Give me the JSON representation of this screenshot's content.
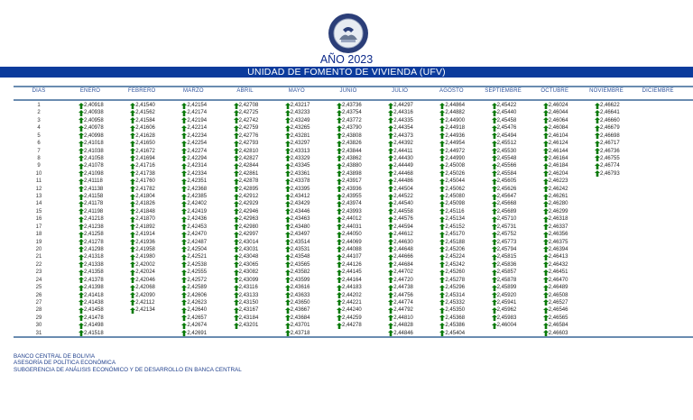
{
  "header": {
    "year_title": "AÑO 2023",
    "band_title": "UNIDAD DE FOMENTO DE VIVIENDA (UFV)",
    "seal_text": "BANCO CENTRAL DE BOLIVIA"
  },
  "table": {
    "day_header": "DIAS",
    "months": [
      "ENERO",
      "FEBRERO",
      "MARZO",
      "ABRIL",
      "MAYO",
      "JUNIO",
      "JULIO",
      "AGOSTO",
      "SEPTIEMBRE",
      "OCTUBRE",
      "NOVIEMBRE",
      "DICIEMBRE"
    ],
    "days": [
      "1",
      "2",
      "3",
      "4",
      "5",
      "6",
      "7",
      "8",
      "9",
      "10",
      "11",
      "12",
      "13",
      "14",
      "15",
      "16",
      "17",
      "18",
      "19",
      "20",
      "21",
      "22",
      "23",
      "24",
      "25",
      "26",
      "27",
      "28",
      "29",
      "30",
      "31"
    ],
    "trend_icon": "green-up-arrow-icon",
    "trend_color": "#0a7a0a",
    "values": [
      [
        "2,40918",
        "2,40938",
        "2,40958",
        "2,40978",
        "2,40998",
        "2,41018",
        "2,41038",
        "2,41058",
        "2,41078",
        "2,41098",
        "2,41118",
        "2,41138",
        "2,41158",
        "2,41178",
        "2,41198",
        "2,41218",
        "2,41238",
        "2,41258",
        "2,41278",
        "2,41298",
        "2,41318",
        "2,41338",
        "2,41358",
        "2,41378",
        "2,41398",
        "2,41418",
        "2,41438",
        "2,41458",
        "2,41478",
        "2,41498",
        "2,41518"
      ],
      [
        "2,41540",
        "2,41562",
        "2,41584",
        "2,41606",
        "2,41628",
        "2,41650",
        "2,41672",
        "2,41694",
        "2,41716",
        "2,41738",
        "2,41760",
        "2,41782",
        "2,41804",
        "2,41826",
        "2,41848",
        "2,41870",
        "2,41892",
        "2,41914",
        "2,41936",
        "2,41958",
        "2,41980",
        "2,42002",
        "2,42024",
        "2,42046",
        "2,42068",
        "2,42090",
        "2,42112",
        "2,42134"
      ],
      [
        "2,42154",
        "2,42174",
        "2,42194",
        "2,42214",
        "2,42234",
        "2,42254",
        "2,42274",
        "2,42294",
        "2,42314",
        "2,42334",
        "2,42351",
        "2,42368",
        "2,42385",
        "2,42402",
        "2,42419",
        "2,42436",
        "2,42453",
        "2,42470",
        "2,42487",
        "2,42504",
        "2,42521",
        "2,42538",
        "2,42555",
        "2,42572",
        "2,42589",
        "2,42606",
        "2,42623",
        "2,42640",
        "2,42657",
        "2,42674",
        "2,42691"
      ],
      [
        "2,42708",
        "2,42725",
        "2,42742",
        "2,42759",
        "2,42776",
        "2,42793",
        "2,42810",
        "2,42827",
        "2,42844",
        "2,42861",
        "2,42878",
        "2,42895",
        "2,42912",
        "2,42929",
        "2,42946",
        "2,42963",
        "2,42980",
        "2,42997",
        "2,43014",
        "2,43031",
        "2,43048",
        "2,43065",
        "2,43082",
        "2,43099",
        "2,43116",
        "2,43133",
        "2,43150",
        "2,43167",
        "2,43184",
        "2,43201"
      ],
      [
        "2,43217",
        "2,43233",
        "2,43249",
        "2,43265",
        "2,43281",
        "2,43297",
        "2,43313",
        "2,43329",
        "2,43345",
        "2,43361",
        "2,43378",
        "2,43395",
        "2,43412",
        "2,43429",
        "2,43446",
        "2,43463",
        "2,43480",
        "2,43497",
        "2,43514",
        "2,43531",
        "2,43548",
        "2,43565",
        "2,43582",
        "2,43599",
        "2,43616",
        "2,43633",
        "2,43650",
        "2,43667",
        "2,43684",
        "2,43701",
        "2,43718"
      ],
      [
        "2,43736",
        "2,43754",
        "2,43772",
        "2,43790",
        "2,43808",
        "2,43826",
        "2,43844",
        "2,43862",
        "2,43880",
        "2,43898",
        "2,43917",
        "2,43936",
        "2,43955",
        "2,43974",
        "2,43993",
        "2,44012",
        "2,44031",
        "2,44050",
        "2,44069",
        "2,44088",
        "2,44107",
        "2,44126",
        "2,44145",
        "2,44164",
        "2,44183",
        "2,44202",
        "2,44221",
        "2,44240",
        "2,44259",
        "2,44278"
      ],
      [
        "2,44297",
        "2,44316",
        "2,44335",
        "2,44354",
        "2,44373",
        "2,44392",
        "2,44411",
        "2,44430",
        "2,44449",
        "2,44468",
        "2,44486",
        "2,44504",
        "2,44522",
        "2,44540",
        "2,44558",
        "2,44576",
        "2,44594",
        "2,44612",
        "2,44630",
        "2,44648",
        "2,44666",
        "2,44684",
        "2,44702",
        "2,44720",
        "2,44738",
        "2,44756",
        "2,44774",
        "2,44792",
        "2,44810",
        "2,44828",
        "2,44846"
      ],
      [
        "2,44864",
        "2,44882",
        "2,44900",
        "2,44918",
        "2,44936",
        "2,44954",
        "2,44972",
        "2,44990",
        "2,45008",
        "2,45026",
        "2,45044",
        "2,45062",
        "2,45080",
        "2,45098",
        "2,45116",
        "2,45134",
        "2,45152",
        "2,45170",
        "2,45188",
        "2,45206",
        "2,45224",
        "2,45242",
        "2,45260",
        "2,45278",
        "2,45296",
        "2,45314",
        "2,45332",
        "2,45350",
        "2,45368",
        "2,45386",
        "2,45404"
      ],
      [
        "2,45422",
        "2,45440",
        "2,45458",
        "2,45476",
        "2,45494",
        "2,45512",
        "2,45530",
        "2,45548",
        "2,45566",
        "2,45584",
        "2,45605",
        "2,45626",
        "2,45647",
        "2,45668",
        "2,45689",
        "2,45710",
        "2,45731",
        "2,45752",
        "2,45773",
        "2,45794",
        "2,45815",
        "2,45836",
        "2,45857",
        "2,45878",
        "2,45899",
        "2,45920",
        "2,45941",
        "2,45962",
        "2,45983",
        "2,46004"
      ],
      [
        "2,46024",
        "2,46044",
        "2,46064",
        "2,46084",
        "2,46104",
        "2,46124",
        "2,46144",
        "2,46164",
        "2,46184",
        "2,46204",
        "2,46223",
        "2,46242",
        "2,46261",
        "2,46280",
        "2,46299",
        "2,46318",
        "2,46337",
        "2,46356",
        "2,46375",
        "2,46394",
        "2,46413",
        "2,46432",
        "2,46451",
        "2,46470",
        "2,46489",
        "2,46508",
        "2,46527",
        "2,46546",
        "2,46565",
        "2,46584",
        "2,46603"
      ],
      [
        "2,46622",
        "2,46641",
        "2,46660",
        "2,46679",
        "2,46698",
        "2,46717",
        "2,46736",
        "2,46755",
        "2,46774",
        "2,46793"
      ],
      []
    ]
  },
  "footer": {
    "line1": "BANCO CENTRAL DE BOLIVIA",
    "line2": "ASESORÍA DE POLÍTICA ECONÓMICA",
    "line3": "SUBGERENCIA DE ANÁLISIS ECONÓMICO Y DE DESARROLLO EN BANCA CENTRAL"
  }
}
